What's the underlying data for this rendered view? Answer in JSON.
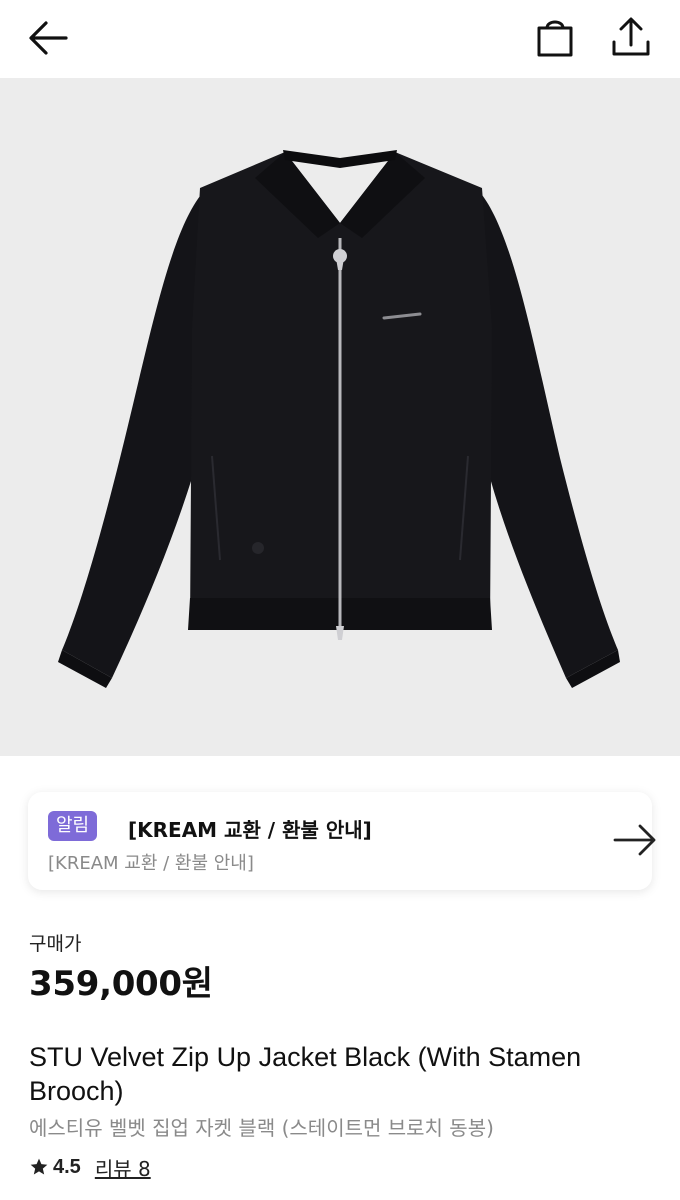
{
  "header": {
    "back_icon": "arrow-left-icon",
    "bag_icon": "shopping-bag-icon",
    "share_icon": "share-upload-icon"
  },
  "product_image": {
    "description_icon": "black-velvet-zip-jacket-image",
    "background": "#ececec"
  },
  "notice": {
    "badge": "알림",
    "title": "[KREAM 교환 / 환불 안내]",
    "subtitle": "[KREAM 교환 / 환불 안내]",
    "arrow_icon": "arrow-right-icon",
    "badge_color": "#7e6bd8"
  },
  "price": {
    "label": "구매가",
    "value": "359,000원"
  },
  "product": {
    "name_en": "STU Velvet Zip Up Jacket Black (With Stamen Brooch)",
    "name_ko": "에스티유 벨벳 집업 자켓 블랙 (스테이트먼 브로치 동봉)",
    "rating": "4.5",
    "reviews": "리뷰 8"
  }
}
